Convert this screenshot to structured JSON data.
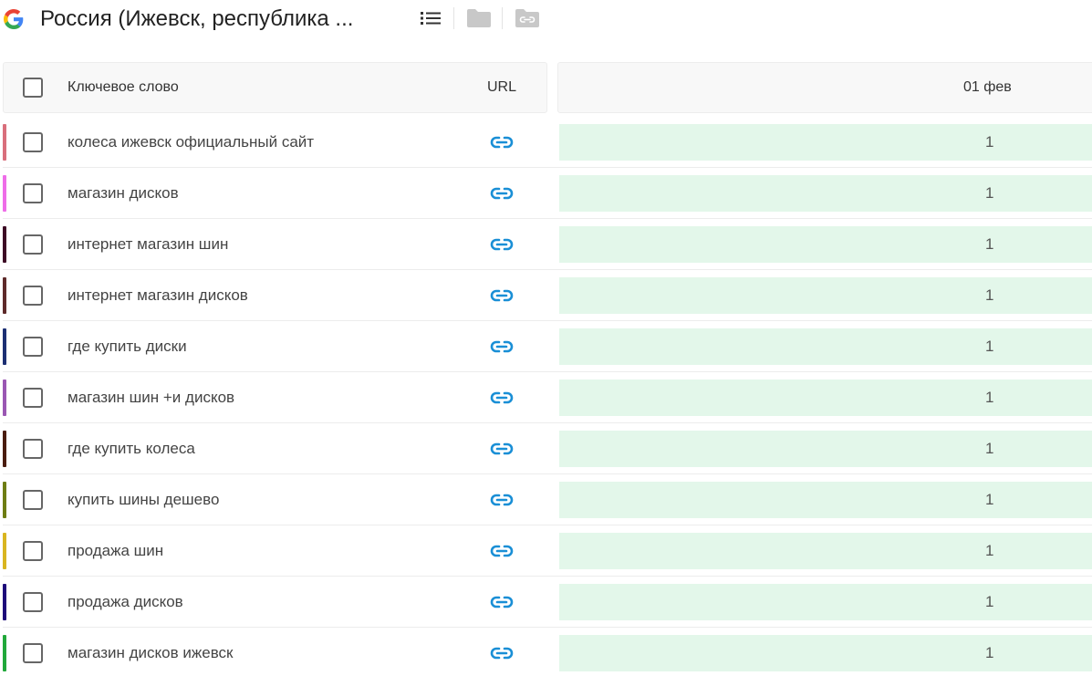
{
  "header": {
    "title": "Россия (Ижевск, республика ...",
    "icons": [
      "google-logo-icon",
      "list-icon",
      "folder-icon",
      "link-folder-icon"
    ],
    "logo_colors": [
      "#4285F4",
      "#EA4335",
      "#FBBC05",
      "#34A853"
    ]
  },
  "table": {
    "columns": {
      "keyword": "Ключевое слово",
      "url": "URL",
      "date": "01 фев"
    },
    "link_color": "#1a8fd6",
    "position_cell_color": "#e3f7ea",
    "rows": [
      {
        "keyword": "колеса ижевск официальный сайт",
        "position": "1",
        "color": "#d96f7c"
      },
      {
        "keyword": "магазин дисков",
        "position": "1",
        "color": "#ee6de8"
      },
      {
        "keyword": "интернет магазин шин",
        "position": "1",
        "color": "#3d0a25"
      },
      {
        "keyword": "интернет магазин дисков",
        "position": "1",
        "color": "#5e2a2a"
      },
      {
        "keyword": "где купить диски",
        "position": "1",
        "color": "#1c2f73"
      },
      {
        "keyword": "магазин шин +и дисков",
        "position": "1",
        "color": "#9a57b3"
      },
      {
        "keyword": "где купить колеса",
        "position": "1",
        "color": "#4a1c0f"
      },
      {
        "keyword": "купить шины дешево",
        "position": "1",
        "color": "#6e7d13"
      },
      {
        "keyword": "продажа шин",
        "position": "1",
        "color": "#d9b520"
      },
      {
        "keyword": "продажа дисков",
        "position": "1",
        "color": "#1d0a7a"
      },
      {
        "keyword": "магазин дисков ижевск",
        "position": "1",
        "color": "#21a83a"
      }
    ]
  }
}
